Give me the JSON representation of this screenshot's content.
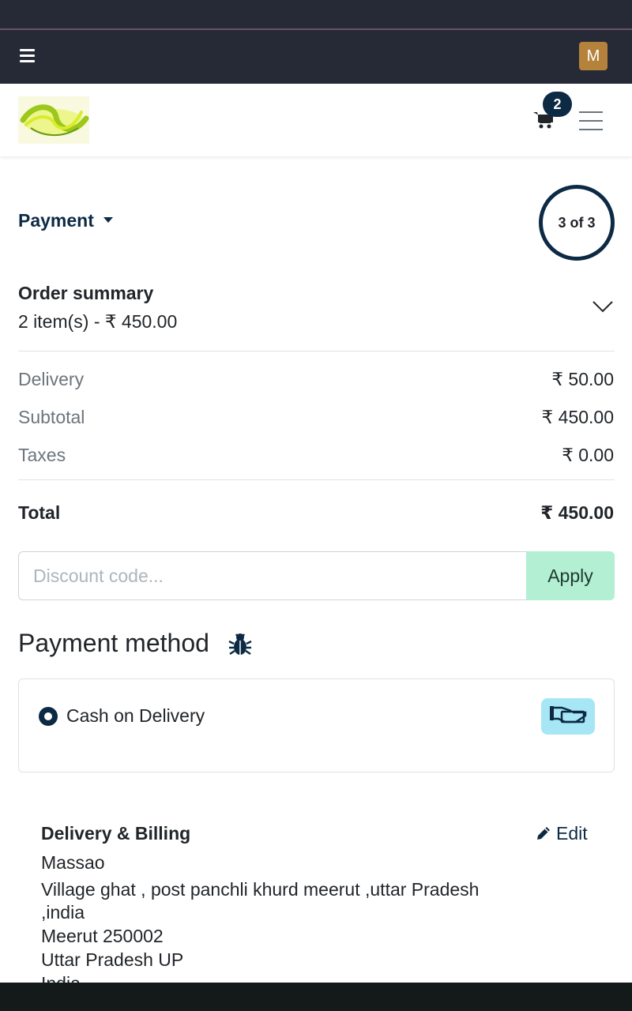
{
  "header": {
    "avatar_initial": "M",
    "cart_count": "2",
    "colors": {
      "topbar": "#262a36",
      "accent": "#0d2a45",
      "avatar": "#b5823c"
    },
    "icons": [
      "menu-icon",
      "cart-icon",
      "hamburger-icon"
    ]
  },
  "checkout": {
    "step_title": "Payment",
    "step_indicator": "3 of 3",
    "summary": {
      "title": "Order summary",
      "subtitle": "2 item(s) -  ₹ 450.00"
    },
    "lines": [
      {
        "label": "Delivery",
        "value": "₹ 50.00"
      },
      {
        "label": "Subtotal",
        "value": "₹ 450.00"
      },
      {
        "label": "Taxes",
        "value": "₹ 0.00"
      }
    ],
    "total": {
      "label": "Total",
      "value": "₹ 450.00"
    },
    "discount": {
      "placeholder": "Discount code...",
      "value": "",
      "apply_label": "Apply"
    },
    "payment_method": {
      "title": "Payment method",
      "options": [
        {
          "label": "Cash on Delivery",
          "selected": true,
          "icon": "cash-hand-icon"
        }
      ]
    },
    "delivery_billing": {
      "title": "Delivery & Billing",
      "edit_label": "Edit",
      "address_lines": [
        "Massao",
        "Village ghat , post panchli khurd meerut ,uttar Pradesh",
        ",india",
        "Meerut 250002",
        "Uttar Pradesh UP",
        "India"
      ]
    }
  }
}
